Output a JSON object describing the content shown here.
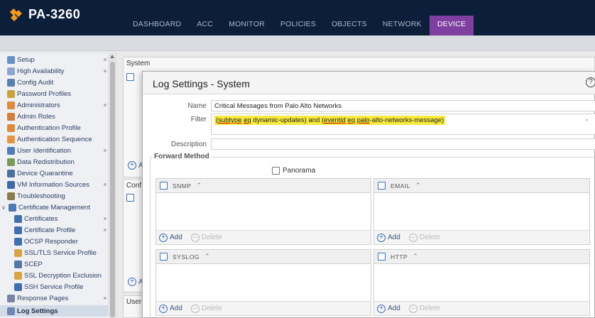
{
  "app": {
    "title": "PA-3260"
  },
  "nav": {
    "tabs": [
      {
        "label": "DASHBOARD"
      },
      {
        "label": "ACC"
      },
      {
        "label": "MONITOR"
      },
      {
        "label": "POLICIES"
      },
      {
        "label": "OBJECTS"
      },
      {
        "label": "NETWORK"
      },
      {
        "label": "DEVICE"
      }
    ],
    "active": "DEVICE"
  },
  "sidebar": {
    "items": [
      {
        "label": "Setup"
      },
      {
        "label": "High Availability"
      },
      {
        "label": "Config Audit"
      },
      {
        "label": "Password Profiles"
      },
      {
        "label": "Administrators"
      },
      {
        "label": "Admin Roles"
      },
      {
        "label": "Authentication Profile"
      },
      {
        "label": "Authentication Sequence"
      },
      {
        "label": "User Identification"
      },
      {
        "label": "Data Redistribution"
      },
      {
        "label": "Device Quarantine"
      },
      {
        "label": "VM Information Sources"
      },
      {
        "label": "Troubleshooting"
      },
      {
        "label": "Certificate Management"
      },
      {
        "label": "Certificates"
      },
      {
        "label": "Certificate Profile"
      },
      {
        "label": "OCSP Responder"
      },
      {
        "label": "SSL/TLS Service Profile"
      },
      {
        "label": "SCEP"
      },
      {
        "label": "SSL Decryption Exclusion"
      },
      {
        "label": "SSH Service Profile"
      },
      {
        "label": "Response Pages"
      },
      {
        "label": "Log Settings"
      }
    ]
  },
  "background": {
    "panel1_title": "System",
    "panel2_title": "Conf",
    "panel3_title": "User-",
    "add_label": "A"
  },
  "modal": {
    "title": "Log Settings - System",
    "help_glyph": "?",
    "name_label": "Name",
    "name_value": "Critical Messages from Palo Alto Networks",
    "filter_label": "Filter",
    "filter_parts": {
      "p1": "(",
      "subtype": "subtype",
      "p2": " ",
      "eq1": "eq",
      "p3": " dynamic-updates) and (",
      "eventid": "eventid",
      "p4": " ",
      "eq2": "eq",
      "p5": " ",
      "palo": "palo",
      "p6": "-alto-networks-message)"
    },
    "description_label": "Description",
    "description_value": "",
    "forward_method_label": "Forward Method",
    "panorama_label": "Panorama",
    "add_label": "Add",
    "delete_label": "Delete",
    "grids": {
      "snmp": "SNMP",
      "email": "EMAIL",
      "syslog": "SYSLOG",
      "http": "HTTP"
    }
  },
  "colors": {
    "topbar": "#0c1f3a",
    "active_tab": "#7e3fa0",
    "filter_highlight": "#f7ea3d",
    "logo_orange": "#f39a1e"
  }
}
